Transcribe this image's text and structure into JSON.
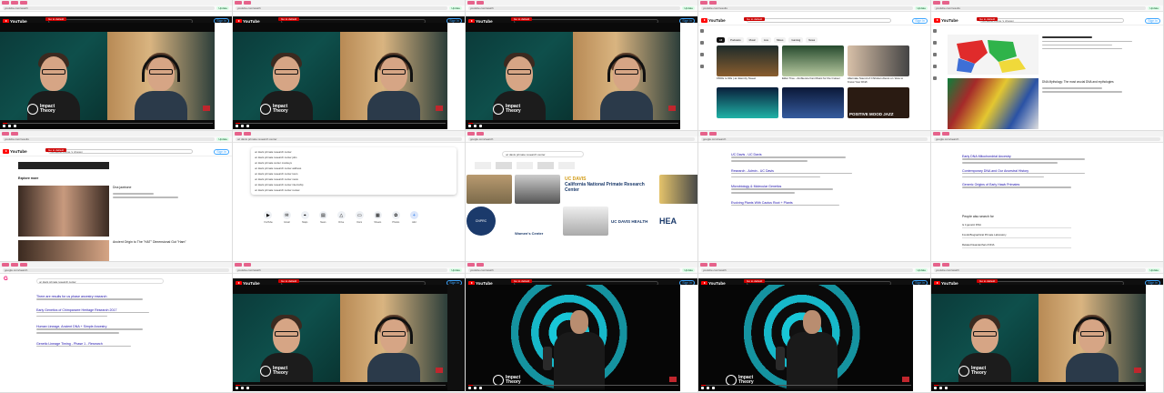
{
  "browser": {
    "url_yt_video": "youtube.com/watch",
    "url_yt_search": "youtube.com/results",
    "url_google_search": "google.com/search",
    "update_label": "Update"
  },
  "youtube": {
    "logo_text": "YouTube",
    "sign_in": "Sign in",
    "live_label": "Go to default",
    "search_placeholder": "",
    "channel_logo_line1": "Impact",
    "channel_logo_line2": "Theory",
    "chips": [
      "All",
      "Podcasts",
      "Music",
      "Live",
      "Mixes",
      "Gaming",
      "News",
      "Ambient",
      "Reggae"
    ],
    "results": [
      {
        "title": "1500s to 90s | an Eternity Sweet",
        "meta": ""
      },
      {
        "title": "Elder Tree - Ambience Fan Music for the Cureer",
        "meta": ""
      },
      {
        "title": "Alternate Sound of Christian Alexis on 'How to Know Your DNA'",
        "meta": ""
      }
    ],
    "search_query": "hot swing thyme 's phagen",
    "explore_more": "Explore more",
    "explore_items": [
      {
        "title": "Dna jawbone"
      },
      {
        "title": "Ancient Origin to The \"HAT\" Dimensional Gut \"Ham\""
      }
    ],
    "positive_mood": "POSITIVE MOOD JAZZ",
    "dna_result_title": "DNA Mythology: The most crucial DNA and mythologies"
  },
  "google": {
    "search_query": "uc davis primate research center",
    "suggestions": [
      "uc davis primate research center",
      "uc davis primate research center jobs",
      "uc davis primate center monkeys",
      "uc davis primate research center address",
      "uc davis primate research center tours",
      "uc davis primate research center news",
      "uc davis primate research center internship",
      "uc davis primate research center review"
    ],
    "shortcuts": [
      "YouTube",
      "Gmail",
      "Maps",
      "News",
      "Drive",
      "Docs",
      "Sheets",
      "Photos",
      "Add"
    ],
    "images_ucd": "UC DAVIS",
    "images_cnprc": "California National Primate Research Center",
    "images_womens": "Women's Center",
    "images_health": "UC DAVIS HEALTH",
    "images_hea": "HEA",
    "images_cnprc_small": "CNPRC",
    "results_a": [
      {
        "title": "UC Davis - UC Davis",
        "snippet": ""
      },
      {
        "title": "Research - Admin - UC Davis",
        "snippet": ""
      },
      {
        "title": "Microbiology & Molecular Genetics",
        "snippet": ""
      },
      {
        "title": "Evolving Plants With Cactus Root + Plants",
        "snippet": ""
      }
    ],
    "results_b": [
      {
        "title": "Early DNA Mitochondrial Ancestry",
        "snippet": ""
      },
      {
        "title": "Contemporary DNA and Our Ancestral History",
        "snippet": ""
      },
      {
        "title": "Generic Origins of Early Hawk Primates",
        "snippet": ""
      }
    ],
    "paa_label": "People also search for",
    "paa": [
      "Is it genetic DNA",
      "Fonds Biographical Primate Laboratory",
      "Related Neanderthal of DNA"
    ],
    "results_c": [
      {
        "title": "There are results for us phase ancestry research"
      },
      {
        "title": "Early Genetics of Chimpanzee Heritage Research 2017"
      },
      {
        "title": "Human Lineage, Ancient DNA + Simple Ancestry"
      },
      {
        "title": "Genetic Lineage Timing - Phase 1 - Research"
      }
    ]
  },
  "player": {
    "progress": 0.02
  }
}
